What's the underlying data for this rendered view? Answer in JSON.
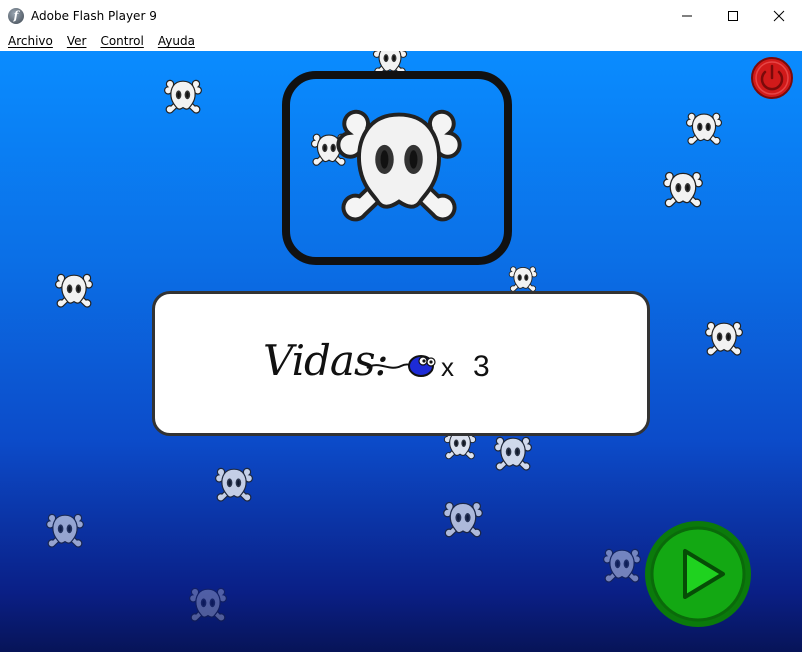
{
  "window": {
    "title": "Adobe Flash Player 9",
    "app_icon_glyph": "f"
  },
  "menu": {
    "items": [
      {
        "label": "Archivo"
      },
      {
        "label": "Ver"
      },
      {
        "label": "Control"
      },
      {
        "label": "Ayuda"
      }
    ]
  },
  "game": {
    "lives_label": "Vidas:",
    "lives_multiplier": "x",
    "lives_count": "3",
    "colors": {
      "stage_top": "#0a8cff",
      "stage_bottom": "#071458",
      "play_green": "#13a813",
      "power_red": "#d11a1a"
    },
    "icons": [
      "skull-crossbones-icon",
      "power-icon",
      "play-icon",
      "sperm-icon"
    ]
  }
}
